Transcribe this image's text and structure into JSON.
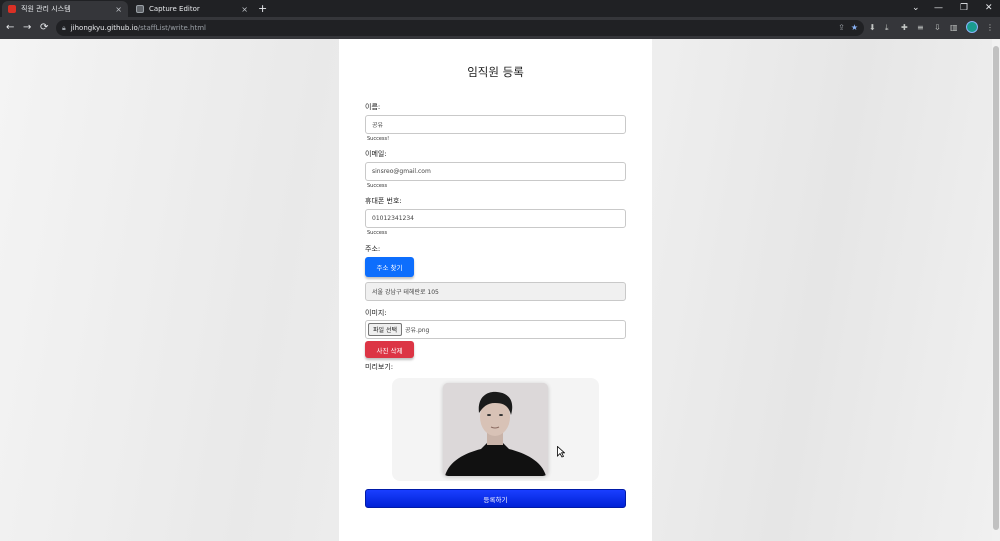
{
  "browser": {
    "tabs": [
      {
        "label": "직원 관리 시스템",
        "close": "×"
      },
      {
        "label": "Capture Editor",
        "close": "×"
      }
    ],
    "new_tab": "+",
    "window_controls": [
      "⌄",
      "—",
      "❐",
      "✕"
    ],
    "nav": {
      "back": "←",
      "forward": "→",
      "reload": "⟳"
    },
    "url_host": "jihongkyu.github.io",
    "url_path": "/staffList/write.html"
  },
  "form": {
    "title": "임직원 등록",
    "name_label": "이름:",
    "name_value": "공유",
    "name_status": "Success!",
    "email_label": "이메일:",
    "email_value": "sinsreo@gmail.com",
    "email_status": "Success",
    "phone_label": "휴대폰 번호:",
    "phone_value": "01012341234",
    "phone_status": "Success",
    "address_label": "주소:",
    "address_button": "주소 찾기",
    "address_value": "서울 강남구 테헤란로 105",
    "image_label": "이미지:",
    "file_button": "파일 선택",
    "file_name": "공유.png",
    "delete_button": "사진 삭제",
    "preview_label": "미리보기:",
    "submit_button": "등록하기"
  },
  "colors": {
    "primary": "#0d6efd",
    "danger": "#dc3545",
    "submit": "#0021d6",
    "chrome_dark": "#202124"
  }
}
